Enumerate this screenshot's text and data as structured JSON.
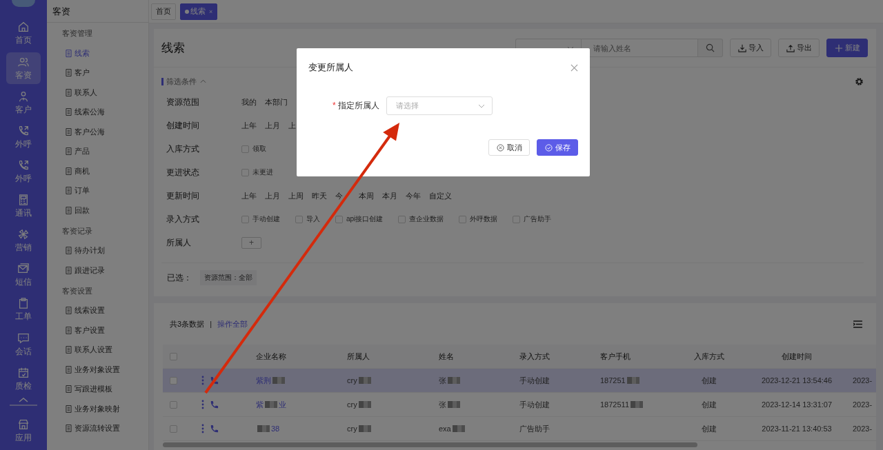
{
  "nav": [
    {
      "kind": "item",
      "label": "首页",
      "selected": false
    },
    {
      "kind": "item",
      "label": "客资",
      "selected": true
    },
    {
      "kind": "item",
      "label": "客户",
      "selected": false
    },
    {
      "kind": "item",
      "label": "外呼",
      "selected": false
    },
    {
      "kind": "item",
      "label": "外呼",
      "selected": false
    },
    {
      "kind": "item",
      "label": "通讯",
      "selected": false
    },
    {
      "kind": "item",
      "label": "营销",
      "selected": false
    },
    {
      "kind": "item",
      "label": "短信",
      "selected": false
    },
    {
      "kind": "item",
      "label": "工单",
      "selected": false
    },
    {
      "kind": "item",
      "label": "会话",
      "selected": false
    },
    {
      "kind": "item",
      "label": "质检",
      "selected": false
    },
    {
      "kind": "toggle"
    },
    {
      "kind": "item",
      "label": "应用",
      "selected": false
    }
  ],
  "submenu": {
    "title": "客资",
    "groups": [
      {
        "title": "客资管理",
        "items": [
          {
            "label": "线索",
            "selected": true
          },
          {
            "label": "客户",
            "selected": false
          },
          {
            "label": "联系人",
            "selected": false
          },
          {
            "label": "线索公海",
            "selected": false
          },
          {
            "label": "客户公海",
            "selected": false
          },
          {
            "label": "产品",
            "selected": false
          },
          {
            "label": "商机",
            "selected": false
          },
          {
            "label": "订单",
            "selected": false
          },
          {
            "label": "回款",
            "selected": false
          }
        ]
      },
      {
        "title": "客资记录",
        "items": [
          {
            "label": "待办计划",
            "selected": false
          },
          {
            "label": "跟进记录",
            "selected": false
          }
        ]
      },
      {
        "title": "客资设置",
        "items": [
          {
            "label": "线索设置",
            "selected": false
          },
          {
            "label": "客户设置",
            "selected": false
          },
          {
            "label": "联系人设置",
            "selected": false
          },
          {
            "label": "业务对象设置",
            "selected": false
          },
          {
            "label": "写跟进模板",
            "selected": false
          },
          {
            "label": "业务对象映射",
            "selected": false
          },
          {
            "label": "资源流转设置",
            "selected": false
          }
        ]
      }
    ]
  },
  "tabs": [
    {
      "label": "首页",
      "selected": false
    },
    {
      "label": "线索",
      "selected": true,
      "close": "×"
    }
  ],
  "header": {
    "title": "线索",
    "search": {
      "placeholder": "请输入姓名"
    },
    "buttons": [
      {
        "kind": "import",
        "label": "导入"
      },
      {
        "kind": "export",
        "label": "导出"
      },
      {
        "kind": "new",
        "label": "新建"
      }
    ]
  },
  "filter": {
    "title": "筛选条件",
    "expanded": true,
    "rows": [
      {
        "label": "资源范围",
        "kind": "options",
        "options": [
          {
            "label": "我的",
            "selected": false
          },
          {
            "label": "本部门",
            "selected": false
          }
        ]
      },
      {
        "label": "创建时间",
        "kind": "options",
        "options": [
          {
            "label": "上年",
            "selected": false
          },
          {
            "label": "上月",
            "selected": false
          },
          {
            "label": "上",
            "selected": false
          }
        ]
      },
      {
        "label": "入库方式",
        "kind": "checks",
        "options": [
          {
            "label": "领取",
            "checked": false
          }
        ]
      },
      {
        "label": "更进状态",
        "kind": "checks",
        "options": [
          {
            "label": "未更进",
            "checked": false
          }
        ]
      },
      {
        "label": "更新时间",
        "kind": "options",
        "options": [
          {
            "label": "上年",
            "selected": false
          },
          {
            "label": "上月",
            "selected": false
          },
          {
            "label": "上周",
            "selected": false
          },
          {
            "label": "昨天",
            "selected": false
          },
          {
            "label": "今",
            "selected": false
          },
          {
            "label": "本周",
            "selected": false
          },
          {
            "label": "本月",
            "selected": false
          },
          {
            "label": "今年",
            "selected": false
          },
          {
            "label": "自定义",
            "selected": false
          }
        ]
      },
      {
        "label": "录入方式",
        "kind": "checks",
        "options": [
          {
            "label": "手动创建",
            "checked": false
          },
          {
            "label": "导入",
            "checked": false
          },
          {
            "label": "api接口创建",
            "checked": false
          },
          {
            "label": "查企业数据",
            "checked": false
          },
          {
            "label": "外呼数据",
            "checked": false
          },
          {
            "label": "广告助手",
            "checked": false
          }
        ]
      },
      {
        "label": "所属人",
        "kind": "add",
        "button": "+"
      }
    ],
    "chosen_label": "已选：",
    "chips": [
      "资源范围：全部"
    ]
  },
  "table": {
    "summary": "共3条数据",
    "separator": "|",
    "link": "操作全部",
    "select_all_checked": false,
    "columns": [
      "企业名称",
      "所属人",
      "姓名",
      "录入方式",
      "客户手机",
      "入库方式",
      "创建时间"
    ],
    "rows": [
      {
        "selected": true,
        "checked": false,
        "cells": [
          {
            "text": "紫荆",
            "redacted": true
          },
          {
            "text": "cry",
            "redacted": true
          },
          {
            "text": "张",
            "redacted": true
          },
          {
            "text": "手动创建"
          },
          {
            "text": "187251",
            "redacted": true
          },
          {
            "text": "创建"
          },
          {
            "text": "2023-12-21 13:54:46"
          },
          {
            "text": "2023-"
          }
        ]
      },
      {
        "selected": false,
        "checked": false,
        "cells": [
          {
            "text": "紫",
            "redacted": true,
            "tail": "业"
          },
          {
            "text": "cry",
            "redacted": true
          },
          {
            "text": "张",
            "redacted": true
          },
          {
            "text": "手动创建"
          },
          {
            "text": "1872511",
            "redacted": true
          },
          {
            "text": "创建"
          },
          {
            "text": "2023-12-14 13:31:07"
          },
          {
            "text": "2023-"
          }
        ]
      },
      {
        "selected": false,
        "checked": false,
        "cells": [
          {
            "redacted": true,
            "tail": "38"
          },
          {
            "text": "cry",
            "redacted": true
          },
          {
            "text": "exa",
            "redacted": true
          },
          {
            "text": "广告助手"
          },
          null,
          {
            "text": "创建"
          },
          {
            "text": "2023-11-21 13:40:53"
          },
          {
            "text": "2023-"
          }
        ]
      }
    ]
  },
  "modal": {
    "title": "变更所属人",
    "field": {
      "required": true,
      "required_mark": "*",
      "label": "指定所属人",
      "placeholder": "请选择"
    },
    "buttons": [
      {
        "kind": "cancel",
        "label": "取消"
      },
      {
        "kind": "save",
        "label": "保存"
      }
    ]
  }
}
